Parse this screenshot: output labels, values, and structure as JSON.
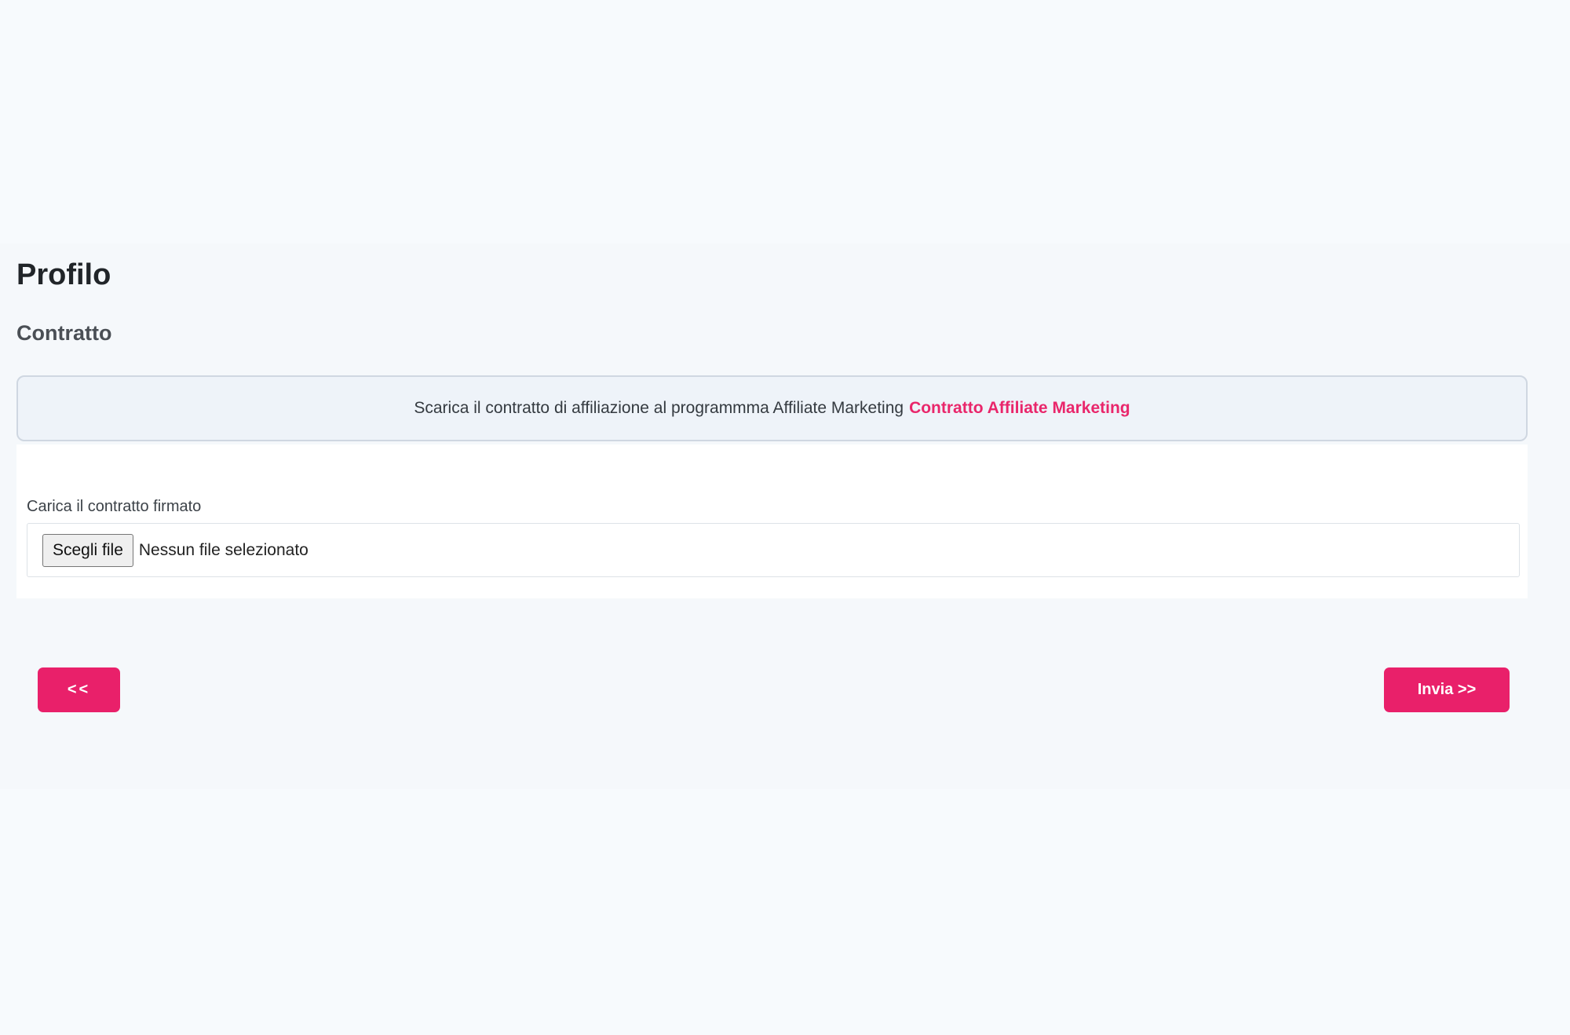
{
  "page": {
    "title": "Profilo",
    "section_title": "Contratto"
  },
  "contract_alert": {
    "text": "Scarica il contratto di affiliazione al programmma Affiliate Marketing",
    "link_label": "Contratto Affiliate Marketing"
  },
  "upload": {
    "label": "Carica il contratto firmato",
    "button_label": "Scegli file",
    "status_text": "Nessun file selezionato"
  },
  "navigation": {
    "back_label": "<<",
    "submit_label": "Invia >>"
  },
  "colors": {
    "accent": "#e9206a",
    "page_background": "#f7fafd",
    "alert_background": "#eef3f9"
  }
}
